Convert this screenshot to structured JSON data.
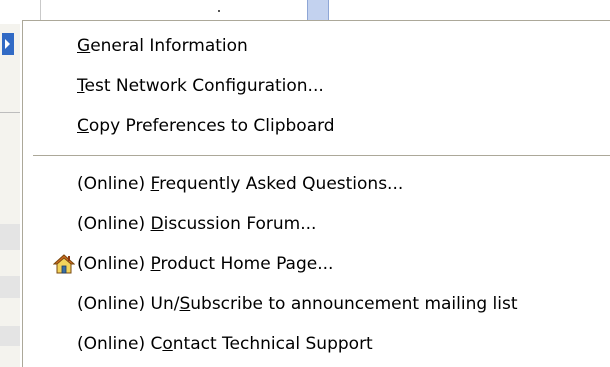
{
  "window": {
    "topbar_has_selection": true
  },
  "menu": {
    "groups": [
      [
        {
          "prefix": "",
          "mnemonic": "G",
          "rest": "eneral Information"
        },
        {
          "prefix": "",
          "mnemonic": "T",
          "rest": "est Network Configuration..."
        },
        {
          "prefix": "",
          "mnemonic": "C",
          "rest": "opy Preferences to Clipboard"
        }
      ],
      [
        {
          "prefix": "(Online) ",
          "mnemonic": "F",
          "rest": "requently Asked Questions..."
        },
        {
          "prefix": "(Online) ",
          "mnemonic": "D",
          "rest": "iscussion Forum..."
        },
        {
          "prefix": "(Online) ",
          "mnemonic": "P",
          "rest": "roduct Home Page...",
          "icon": "home-icon"
        },
        {
          "prefix": "(Online) Un/",
          "mnemonic": "S",
          "rest": "ubscribe to announcement mailing list"
        },
        {
          "prefix": "(Online) C",
          "mnemonic": "o",
          "rest": "ntact Technical Support"
        }
      ]
    ]
  },
  "colors": {
    "menu_bg": "#ffffff",
    "menu_border": "#aca899",
    "selection_blue": "#316ac5",
    "home_roof": "#d46a1f",
    "home_wall": "#f2d35c"
  }
}
